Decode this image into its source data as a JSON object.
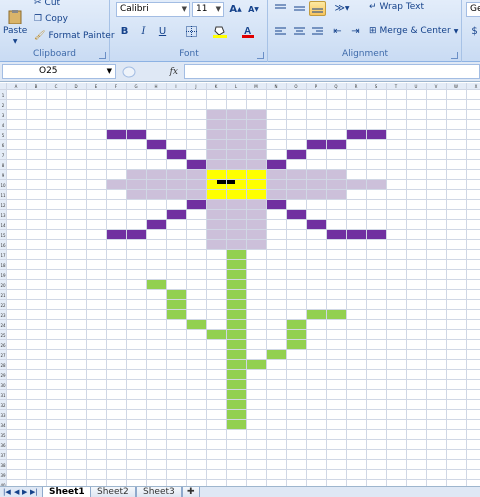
{
  "ribbon": {
    "clipboard": {
      "label": "Clipboard",
      "paste": "Paste",
      "cut": "Cut",
      "copy": "Copy",
      "format_painter": "Format Painter"
    },
    "font": {
      "label": "Font",
      "name": "Calibri",
      "size": "11"
    },
    "alignment": {
      "label": "Alignment",
      "wrap_text": "Wrap Text",
      "merge_center": "Merge & Center"
    },
    "number_partial": "Ge"
  },
  "formula_bar": {
    "name_box": "O25",
    "fx": "fx"
  },
  "grid": {
    "column_headers": [
      "A",
      "B",
      "C",
      "D",
      "E",
      "F",
      "G",
      "H",
      "I",
      "J",
      "K",
      "L",
      "M",
      "N",
      "O",
      "P",
      "Q",
      "R",
      "S",
      "T",
      "U",
      "V",
      "W",
      "X",
      "Y"
    ],
    "row_count": 40,
    "colors": {
      "purple": "#7030a0",
      "lavender": "#ccc0da",
      "yellow": "#ffff00",
      "black": "#000000",
      "green": "#92d050"
    }
  },
  "sheets": {
    "tabs": [
      "Sheet1",
      "Sheet2",
      "Sheet3"
    ],
    "active": "Sheet1"
  }
}
